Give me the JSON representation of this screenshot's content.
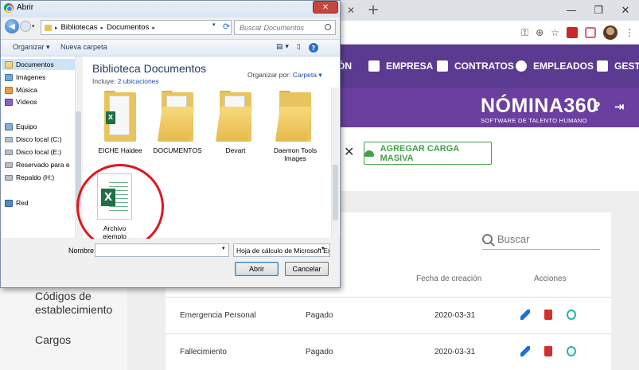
{
  "browser": {
    "window_controls": [
      "—",
      "❐",
      "✕"
    ],
    "new_tab": "+",
    "tab_close": "✕",
    "menu": "⋮"
  },
  "app": {
    "nav": [
      {
        "label": "ÓN"
      },
      {
        "label": "EMPRESA"
      },
      {
        "label": "CONTRATOS"
      },
      {
        "label": "EMPLEADOS"
      },
      {
        "label": "GESTI"
      }
    ],
    "logo": {
      "name": "NÓMINA360",
      "tagline": "SOFTWARE DE TALENTO HUMANO"
    },
    "header_icons": {
      "help": "?",
      "logout": "⇥"
    },
    "sidebar": [
      {
        "label": "Códigos de"
      },
      {
        "label": "establecimiento"
      },
      {
        "label": "Cargos"
      }
    ],
    "close_x": "✕",
    "bulk_button": "AGREGAR CARGA MASIVA",
    "search_placeholder": "Buscar",
    "table": {
      "headers": [
        "Fecha de creación",
        "Acciones"
      ],
      "rows": [
        {
          "name": "Emergencia Personal",
          "status": "Pagado",
          "date": "2020-03-31"
        },
        {
          "name": "Fallecimiento",
          "status": "Pagado",
          "date": "2020-03-31"
        }
      ]
    }
  },
  "dialog": {
    "title": "Abrir",
    "close": "✕",
    "back": "◀",
    "dropdown": "▾",
    "path": [
      "Bibliotecas",
      "Documentos"
    ],
    "path_sep": "▸",
    "refresh": "⟳",
    "search_placeholder": "Buscar Documentos",
    "toolbar": {
      "organize": "Organizar ▾",
      "new_folder": "Nueva carpeta",
      "view": "▤ ▾",
      "preview": "▯",
      "help": "?"
    },
    "nav_items": [
      {
        "label": "Documentos",
        "icon": "document-library-icon"
      },
      {
        "label": "Imágenes",
        "icon": "pictures-icon"
      },
      {
        "label": "Música",
        "icon": "music-icon"
      },
      {
        "label": "Vídeos",
        "icon": "videos-icon"
      },
      {
        "label": "Equipo",
        "icon": "computer-icon"
      },
      {
        "label": "Disco local (C:)",
        "icon": "disk-icon"
      },
      {
        "label": "Disco local (E:)",
        "icon": "disk-icon"
      },
      {
        "label": "Reservado para e",
        "icon": "disk-icon"
      },
      {
        "label": "Repaldo (H:)",
        "icon": "disk-icon"
      },
      {
        "label": "Red",
        "icon": "network-icon"
      }
    ],
    "library_title": "Biblioteca Documentos",
    "library_includes": "Incluye:",
    "library_locations": "2 ubicaciones",
    "organize_by_label": "Organizar por:",
    "organize_by_value": "Carpeta ▾",
    "items": [
      {
        "label": "EICHE Haidee"
      },
      {
        "label": "DOCUMENTOS"
      },
      {
        "label": "Devart"
      },
      {
        "label": "Daemon Tools Images"
      },
      {
        "label": "Archivo ejemplo"
      }
    ],
    "filename_label": "Nombre:",
    "filename_value": "",
    "filetype": "Hoja de cálculo de Microsoft Excel",
    "open_button": "Abrir",
    "cancel_button": "Cancelar"
  }
}
